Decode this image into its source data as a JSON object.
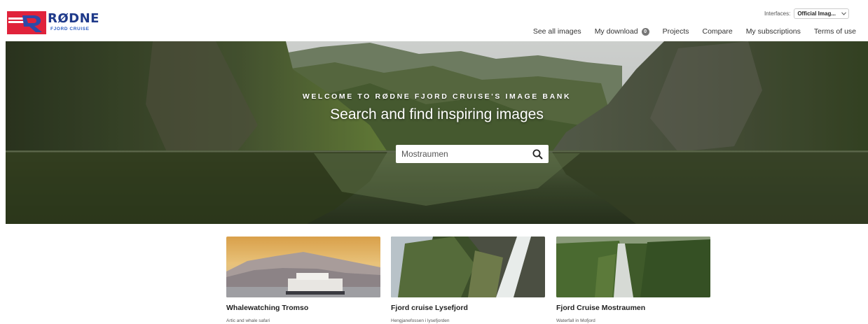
{
  "brand": {
    "name": "RØDNE",
    "subtitle": "FJORD CRUISE",
    "primary_color": "#1f3a8a",
    "accent_color": "#e0233b"
  },
  "interfaces": {
    "label": "Interfaces:",
    "selected": "Official Imag..."
  },
  "nav": {
    "items": [
      {
        "label": "See all images"
      },
      {
        "label": "My download",
        "badge": "0"
      },
      {
        "label": "Projects"
      },
      {
        "label": "Compare"
      },
      {
        "label": "My subscriptions"
      },
      {
        "label": "Terms of use"
      }
    ]
  },
  "hero": {
    "kicker": "WELCOME TO RØDNE FJORD CRUISE'S IMAGE BANK",
    "title": "Search and find inspiring images",
    "search_value": "Mostraumen"
  },
  "cards": [
    {
      "title": "Whalewatching Tromso",
      "subtitle": "Artic and whale safari"
    },
    {
      "title": "Fjord cruise Lysefjord",
      "subtitle": "Hengjanefossen i lysefjorden"
    },
    {
      "title": "Fjord Cruise Mostraumen",
      "subtitle": "Waterfall in Mofjord"
    }
  ]
}
